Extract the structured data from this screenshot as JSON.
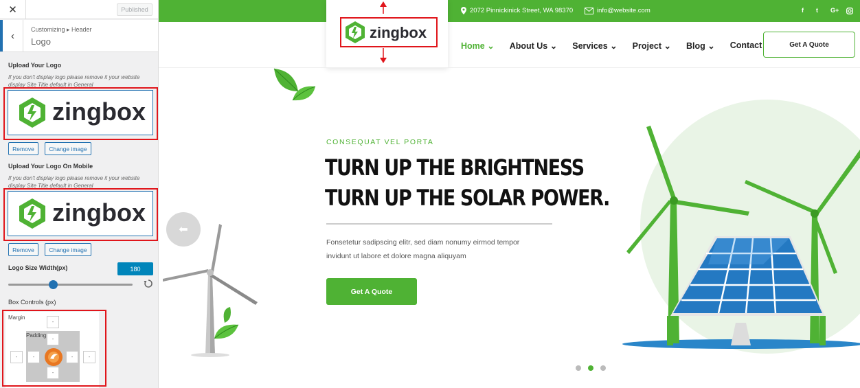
{
  "customizer": {
    "close_icon": "close-icon",
    "publish_label": "Published",
    "breadcrumb": "Customizing ▸ Header",
    "section_title": "Logo",
    "upload_logo_label": "Upload Your Logo",
    "upload_logo_desc": "If you don't display logo please remove it your website display Site Title default in General",
    "remove_label": "Remove",
    "change_image_label": "Change image",
    "upload_mobile_label": "Upload Your Logo On Mobile",
    "upload_mobile_desc": "If you don't display logo please remove it your website display Site Title default in General",
    "logo_size_label": "Logo Size Width(px)",
    "logo_size_value": "180",
    "box_controls_label": "Box Controls (px)",
    "margin_label": "Margin",
    "padding_label": "Padding",
    "box_input_placeholder": "-"
  },
  "logo": {
    "text": "zingbox",
    "color_green": "#4fb234",
    "color_dark": "#2a2a30"
  },
  "site": {
    "address": "2072 Pinnickinick Street, WA 98370",
    "email": "info@website.com",
    "social": [
      "f",
      "t",
      "G+",
      "ig"
    ],
    "nav": [
      {
        "label": "Home",
        "dropdown": true,
        "active": true
      },
      {
        "label": "About Us",
        "dropdown": true
      },
      {
        "label": "Services",
        "dropdown": true
      },
      {
        "label": "Project",
        "dropdown": true
      },
      {
        "label": "Blog",
        "dropdown": true
      },
      {
        "label": "Contact",
        "dropdown": false
      }
    ],
    "header_cta": "Get A Quote",
    "hero": {
      "subtitle": "CONSEQUAT VEL PORTA",
      "title_line1": "TURN UP THE BRIGHTNESS",
      "title_line2": "TURN UP THE SOLAR POWER.",
      "text": "Fonsetetur sadipscing elitr, sed diam nonumy eirmod tempor invidunt ut labore et dolore magna aliquyam",
      "cta": "Get A Quote"
    },
    "slider_dots": 3,
    "active_dot": 2,
    "brand_color": "#4fb234"
  }
}
